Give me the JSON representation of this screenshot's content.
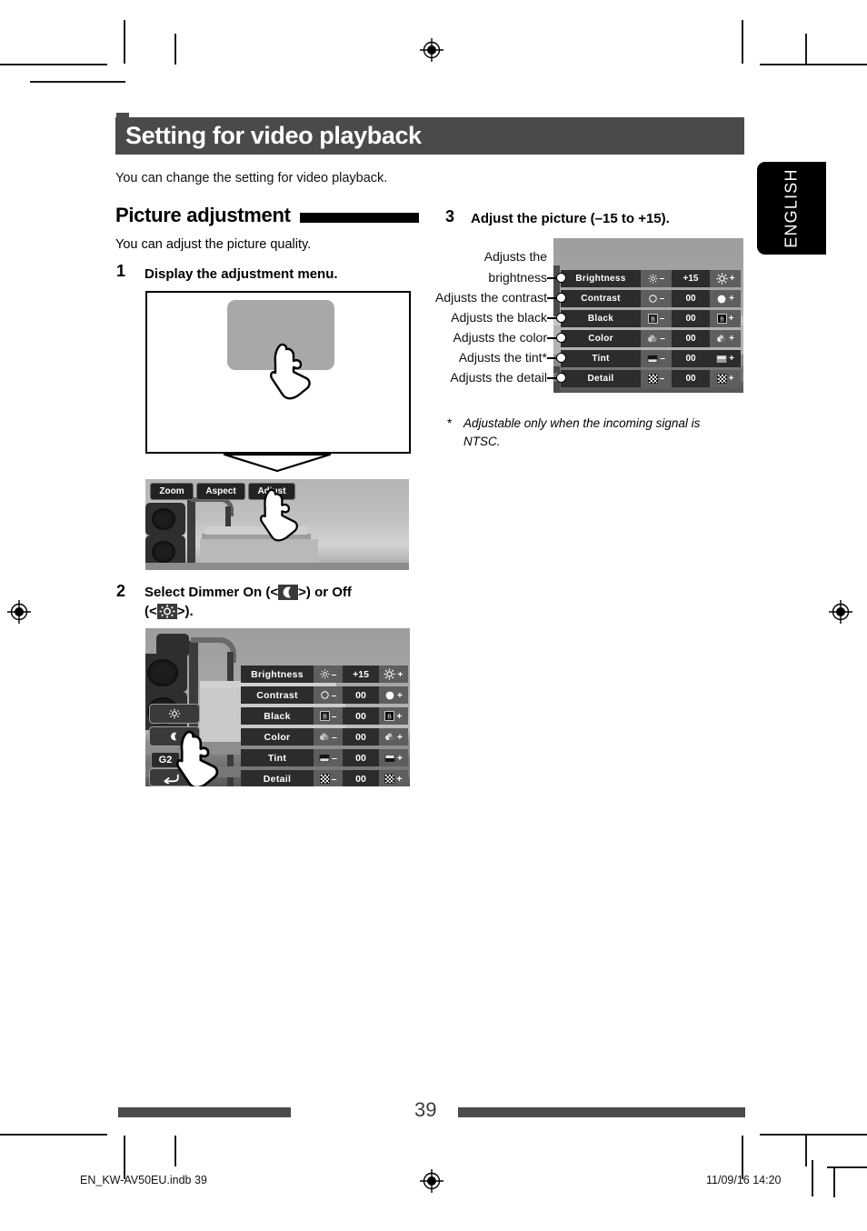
{
  "language_tab": {
    "label": "ENGLISH"
  },
  "banner": {
    "title": "Setting for video playback"
  },
  "intro": "You can change the setting for video playback.",
  "section": {
    "heading": "Picture adjustment",
    "subtitle": "You can adjust the picture quality."
  },
  "steps": [
    {
      "num": "1",
      "text": "Display the adjustment menu."
    },
    {
      "num": "2",
      "text_a": "Select Dimmer On (<",
      "text_b": ">) or Off",
      "text_c": "(<",
      "text_d": ">).",
      "icon_on": "moon-icon",
      "icon_off": "dimmer-off-icon"
    },
    {
      "num": "3",
      "text": "Adjust the picture (–15 to +15)."
    }
  ],
  "control_bar": {
    "buttons": [
      {
        "label": "Zoom",
        "name": "zoom-button"
      },
      {
        "label": "Aspect",
        "name": "aspect-button"
      },
      {
        "label": "Adjust",
        "name": "adjust-button"
      }
    ]
  },
  "dimmer_panel": {
    "off_icon": "dimmer-off-icon",
    "on_icon": "moon-icon",
    "group_tag": "G2",
    "return_icon": "return-arrow-icon"
  },
  "osd_menu": {
    "minus_sign": "–",
    "plus_sign": "+",
    "rows": [
      {
        "label": "Brightness",
        "value": "+15",
        "minus_icon": "brightness-small-icon",
        "plus_icon": "brightness-large-icon"
      },
      {
        "label": "Contrast",
        "value": "00",
        "minus_icon": "contrast-hollow-icon",
        "plus_icon": "contrast-filled-icon"
      },
      {
        "label": "Black",
        "value": "00",
        "minus_icon": "black-level-dark-icon",
        "plus_icon": "black-level-light-icon"
      },
      {
        "label": "Color",
        "value": "00",
        "minus_icon": "color-pale-icon",
        "plus_icon": "color-vivid-icon"
      },
      {
        "label": "Tint",
        "value": "00",
        "minus_icon": "tint-low-icon",
        "plus_icon": "tint-high-icon"
      },
      {
        "label": "Detail",
        "value": "00",
        "minus_icon": "detail-soft-icon",
        "plus_icon": "detail-sharp-icon"
      }
    ]
  },
  "callouts": [
    {
      "line1": "Adjusts the",
      "line2": "brightness"
    },
    {
      "line1": "Adjusts the contrast"
    },
    {
      "line1": "Adjusts the black"
    },
    {
      "line1": "Adjusts the color"
    },
    {
      "line1": "Adjusts the tint*"
    },
    {
      "line1": "Adjusts the detail"
    }
  ],
  "footnote": {
    "marker": "*",
    "text": "Adjustable only when the incoming signal is NTSC."
  },
  "footer": {
    "page_number": "39",
    "file_name": "EN_KW-AV50EU.indb   39",
    "timestamp": "11/09/16   14:20"
  },
  "colors": {
    "banner_bg": "#4a4a4a",
    "rule": "#4a4a4a",
    "osd_row": "#2c2c2c",
    "osd_button": "#5e5e5e",
    "tab_bg": "#000000"
  }
}
